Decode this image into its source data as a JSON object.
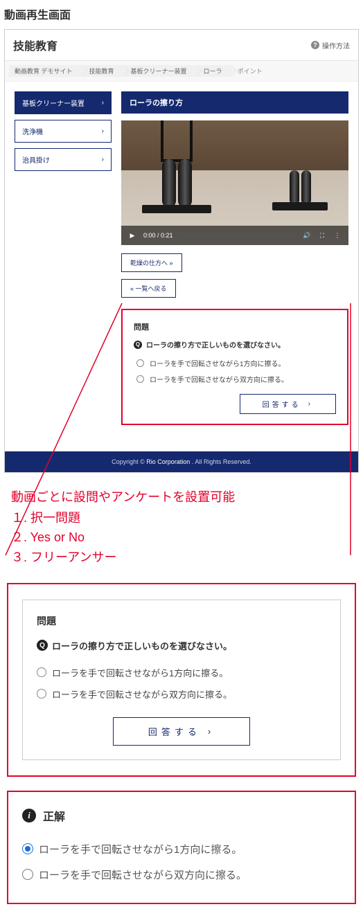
{
  "page_title": "動画再生画面",
  "header": {
    "title": "技能教育",
    "help_label": "操作方法"
  },
  "breadcrumbs": [
    "動画教育 デモサイト",
    "技能教育",
    "基板クリーナー装置",
    "ローラ",
    "ポイント"
  ],
  "sidebar": {
    "items": [
      {
        "label": "基板クリーナー装置",
        "active": true
      },
      {
        "label": "洗浄機",
        "active": false
      },
      {
        "label": "治具掛け",
        "active": false
      }
    ]
  },
  "section_title": "ローラの擦り方",
  "video": {
    "time": "0:00 / 0:21"
  },
  "buttons": {
    "next": "乾燥の仕方へ »",
    "back": "« 一覧へ戻る",
    "answer": "回答する"
  },
  "quiz": {
    "title": "問題",
    "prompt": "ローラの擦り方で正しいものを選びなさい。",
    "options": [
      "ローラを手で回転させながら1方向に擦る。",
      "ローラを手で回転させながら双方向に擦る。"
    ]
  },
  "footer": {
    "prefix": "Copyright © ",
    "link": "Rio Corporation",
    "suffix": ". All Rights Reserved."
  },
  "annotation": {
    "heading": "動画ごとに設問やアンケートを設置可能",
    "items": [
      "１. 択一問題",
      "２. Yes or No",
      "３. フリーアンサー"
    ]
  },
  "answer_panel": {
    "title": "正解",
    "options": [
      {
        "label": "ローラを手で回転させながら1方向に擦る。",
        "selected": true
      },
      {
        "label": "ローラを手で回転させながら双方向に擦る。",
        "selected": false
      }
    ]
  }
}
